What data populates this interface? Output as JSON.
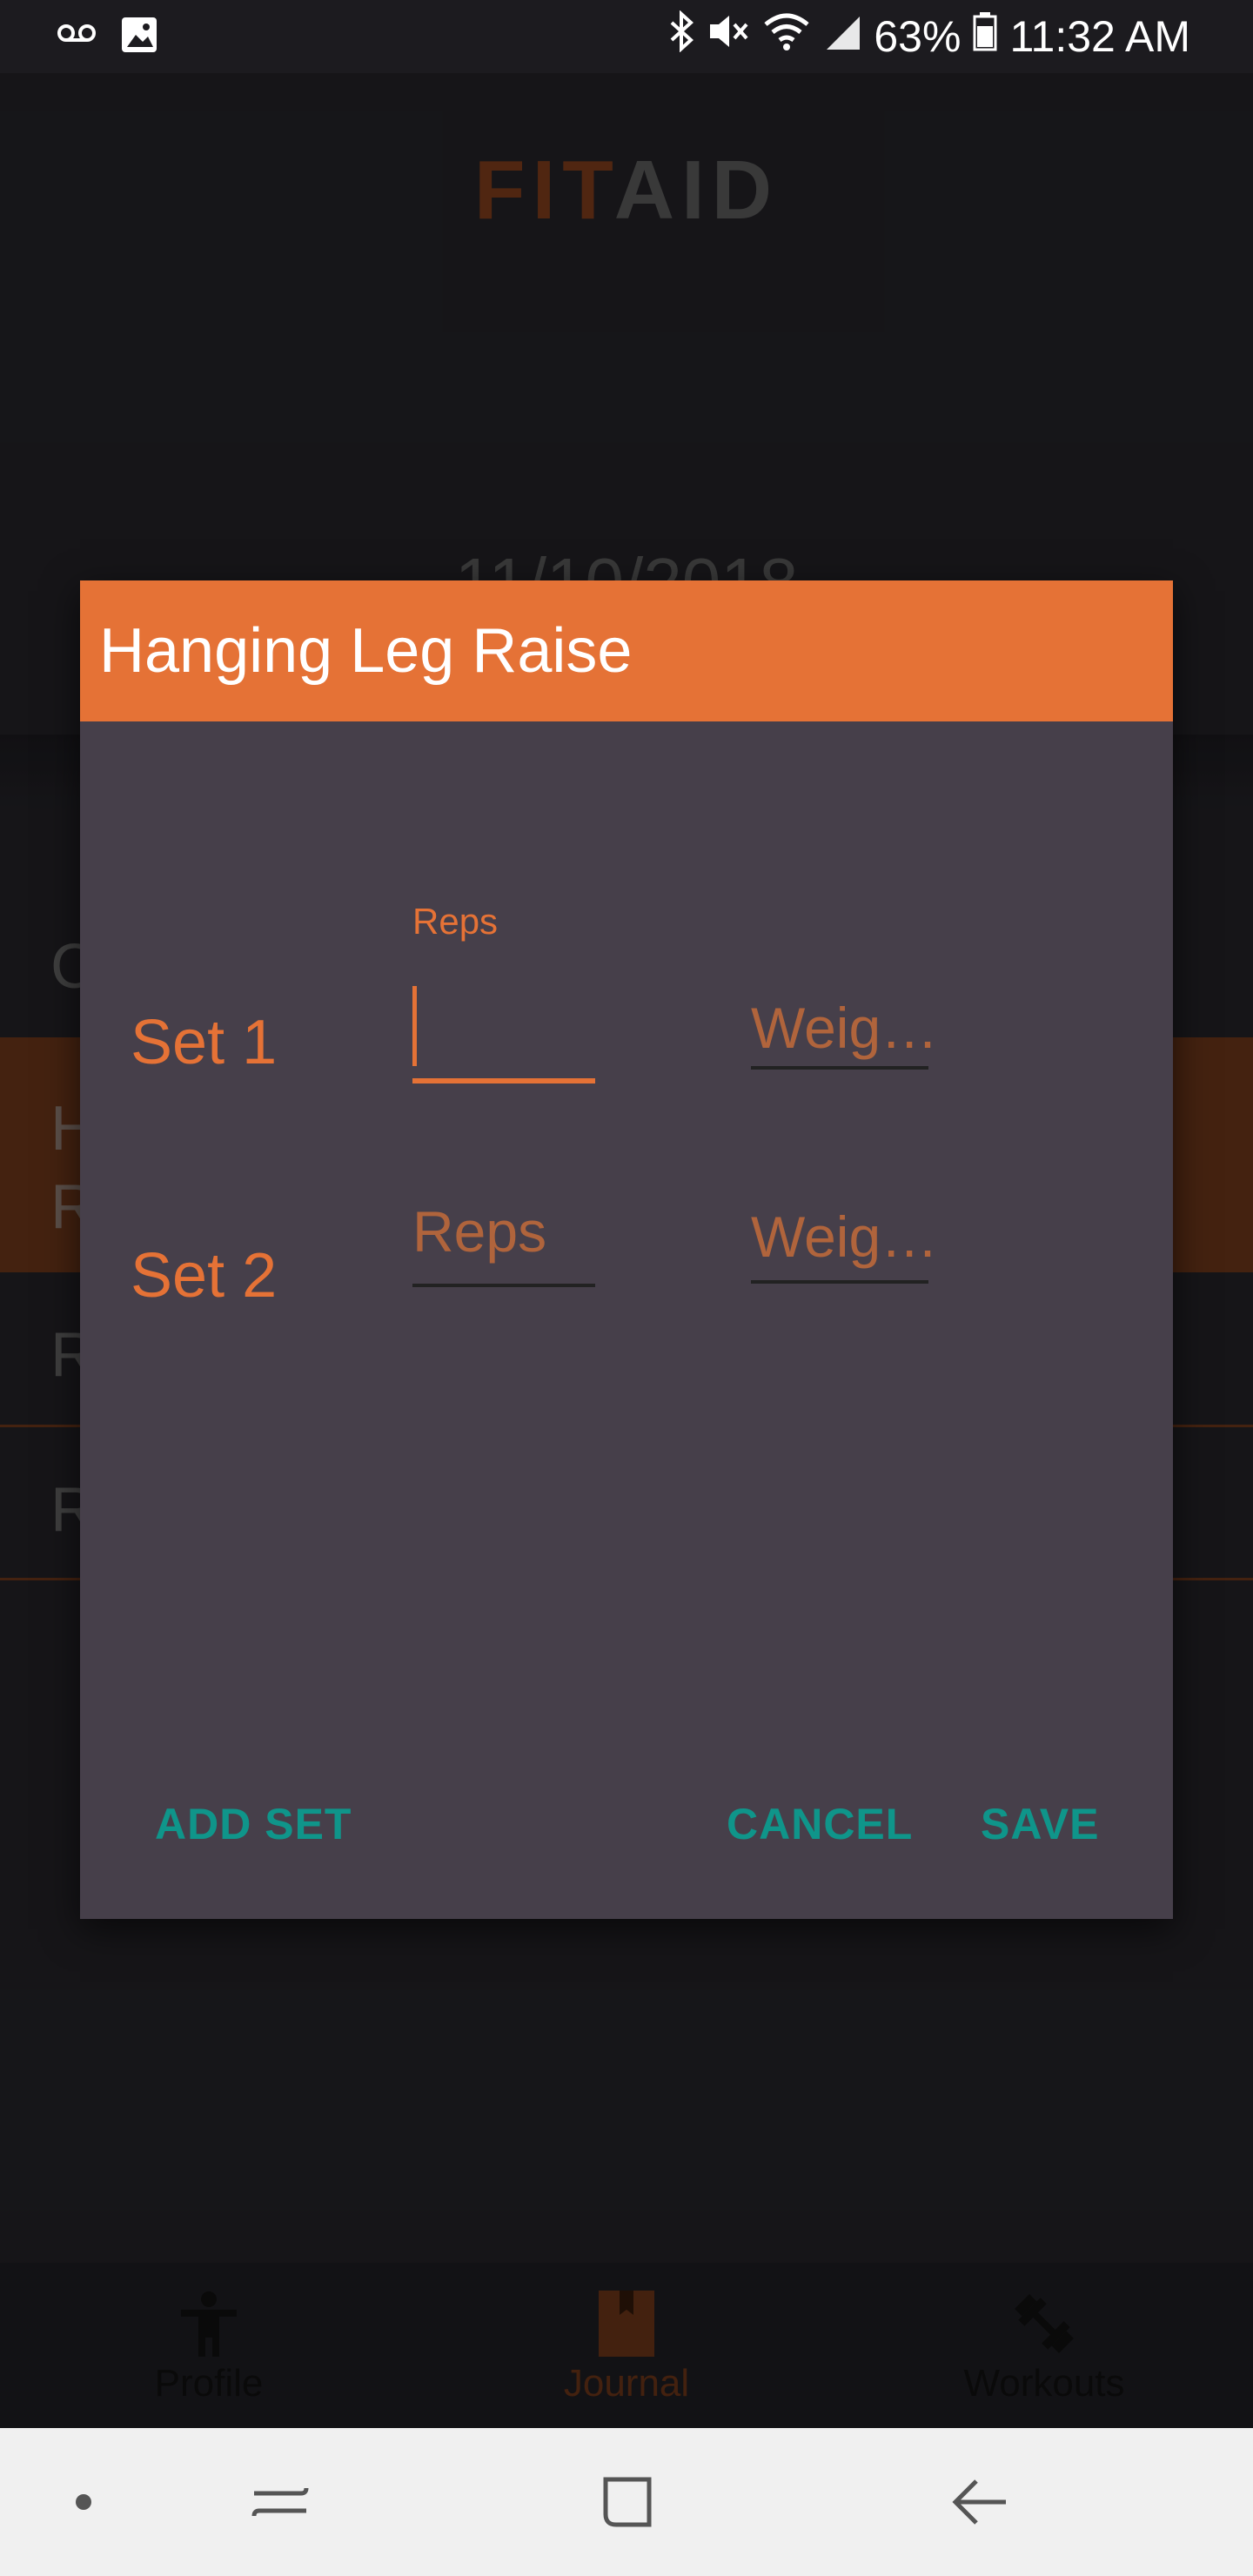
{
  "status_bar": {
    "left_icons": [
      "voicemail-icon",
      "image-icon"
    ],
    "right_icons": [
      "bluetooth-icon",
      "mute-icon",
      "wifi-icon",
      "signal-icon"
    ],
    "battery_percent": "63%",
    "time": "11:32 AM"
  },
  "app": {
    "logo_part1": "FIT",
    "logo_part2": "AID",
    "date": "11/10/2018",
    "rows": [
      "C",
      "H\nR",
      "R",
      "R"
    ]
  },
  "dialog": {
    "title": "Hanging Leg Raise",
    "sets": [
      {
        "label": "Set 1",
        "reps_label": "Reps",
        "reps_value": "",
        "weight_placeholder": "Weig…"
      },
      {
        "label": "Set 2",
        "reps_placeholder": "Reps",
        "weight_placeholder": "Weig…"
      }
    ],
    "buttons": {
      "add_set": "ADD SET",
      "cancel": "CANCEL",
      "save": "SAVE"
    }
  },
  "bottom_nav": {
    "items": [
      {
        "label": "Profile",
        "icon": "person-icon"
      },
      {
        "label": "Journal",
        "icon": "journal-icon",
        "active": true
      },
      {
        "label": "Workouts",
        "icon": "dumbbell-icon"
      }
    ]
  },
  "colors": {
    "accent": "#e57236",
    "dialog_bg": "#463f4a",
    "button_text": "#0f958a",
    "app_bg": "#1e1d21"
  }
}
